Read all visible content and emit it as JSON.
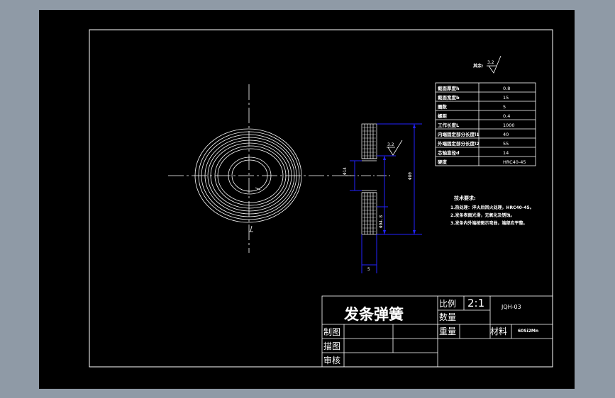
{
  "drawing": {
    "roughness_label": "其余:",
    "roughness_value": "3.2",
    "roughness_value_2": "3.2",
    "spec_table": [
      {
        "label": "截面厚度h",
        "value": "0.8"
      },
      {
        "label": "截面宽度b",
        "value": "15"
      },
      {
        "label": "圈数",
        "value": "5"
      },
      {
        "label": "螺距",
        "value": "0.4"
      },
      {
        "label": "工作长度L",
        "value": "1000"
      },
      {
        "label": "内端固定部分长度l1",
        "value": "40"
      },
      {
        "label": "外端固定部分长度l2",
        "value": "55"
      },
      {
        "label": "芯轴直径d",
        "value": "14"
      },
      {
        "label": "硬度",
        "value": "HRC40-45"
      }
    ],
    "technical_requirements": {
      "title": "技术要求:",
      "items": [
        "1.热处理：淬火后回火处理，HRC40-45。",
        "2.发条表面光滑，无氧化及锈蚀。",
        "3.发条内外端按图示弯曲，端部应平整。"
      ]
    },
    "dimensions": {
      "inner_hole": "Φ14",
      "outer_dia": "Φ80",
      "side_dia": "Φ94.8",
      "width": "5"
    }
  },
  "title_block": {
    "part_name": "发条弹簧",
    "scale_label": "比例",
    "scale_value": "2:1",
    "drawing_no": "JQH-03",
    "qty_label": "数量",
    "weight_label": "重量",
    "material_label": "材料",
    "material_value": "60Si2Mn",
    "drawn_by_label": "制图",
    "traced_by_label": "描图",
    "checked_by_label": "审核"
  }
}
